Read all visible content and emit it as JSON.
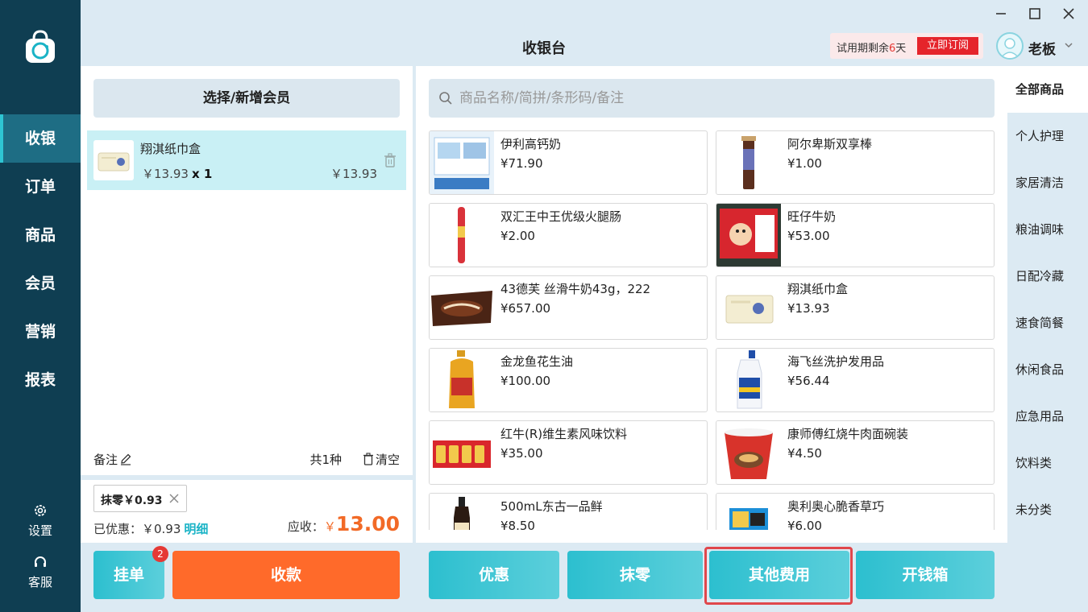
{
  "header": {
    "title": "收银台",
    "trial_prefix": "试用期剩余",
    "trial_days": "6",
    "trial_suffix": "天",
    "subscribe_label": "立即订阅",
    "username": "老板"
  },
  "nav": {
    "items": [
      {
        "label": "收银",
        "active": true
      },
      {
        "label": "订单"
      },
      {
        "label": "商品"
      },
      {
        "label": "会员"
      },
      {
        "label": "营销"
      },
      {
        "label": "报表"
      }
    ],
    "settings_label": "设置",
    "service_label": "客服"
  },
  "cart": {
    "member_button": "选择/新增会员",
    "item": {
      "name": "翔淇纸巾盒",
      "price": "￥13.93",
      "qty": "x 1",
      "subtotal": "￥13.93"
    },
    "note_label": "备注",
    "count_label": "共1种",
    "clear_label": "清空",
    "round_tag": "抹零￥0.93",
    "discount_label": "已优惠：￥0.93",
    "detail_link": "明细",
    "due_label": "应收：",
    "due_currency": "￥",
    "due_amount": "13.00"
  },
  "actions": {
    "hold_label": "挂单",
    "hold_badge": "2",
    "pay_label": "收款",
    "discount_label": "优惠",
    "round_label": "抹零",
    "other_fee_label": "其他费用",
    "cash_drawer_label": "开钱箱"
  },
  "search": {
    "placeholder": "商品名称/简拼/条形码/备注"
  },
  "products": [
    {
      "name": "伊利高钙奶",
      "price": "¥71.90"
    },
    {
      "name": "阿尔卑斯双享棒",
      "price": "¥1.00"
    },
    {
      "name": "双汇王中王优级火腿肠",
      "price": "¥2.00"
    },
    {
      "name": "旺仔牛奶",
      "price": "¥53.00"
    },
    {
      "name": "43德芙 丝滑牛奶43g，222",
      "price": "¥657.00"
    },
    {
      "name": "翔淇纸巾盒",
      "price": "¥13.93"
    },
    {
      "name": "金龙鱼花生油",
      "price": "¥100.00"
    },
    {
      "name": "海飞丝洗护发用品",
      "price": "¥56.44"
    },
    {
      "name": "红牛(R)维生素风味饮料",
      "price": "¥35.00"
    },
    {
      "name": "康师傅红烧牛肉面碗装",
      "price": "¥4.50"
    },
    {
      "name": "500mL东古一品鲜",
      "price": "¥8.50"
    },
    {
      "name": "奥利奥心脆香草巧",
      "price": "¥6.00"
    }
  ],
  "categories": [
    {
      "label": "全部商品",
      "active": true
    },
    {
      "label": "个人护理"
    },
    {
      "label": "家居清洁"
    },
    {
      "label": "粮油调味"
    },
    {
      "label": "日配冷藏"
    },
    {
      "label": "速食简餐"
    },
    {
      "label": "休闲食品"
    },
    {
      "label": "应急用品"
    },
    {
      "label": "饮料类"
    },
    {
      "label": "未分类"
    }
  ]
}
